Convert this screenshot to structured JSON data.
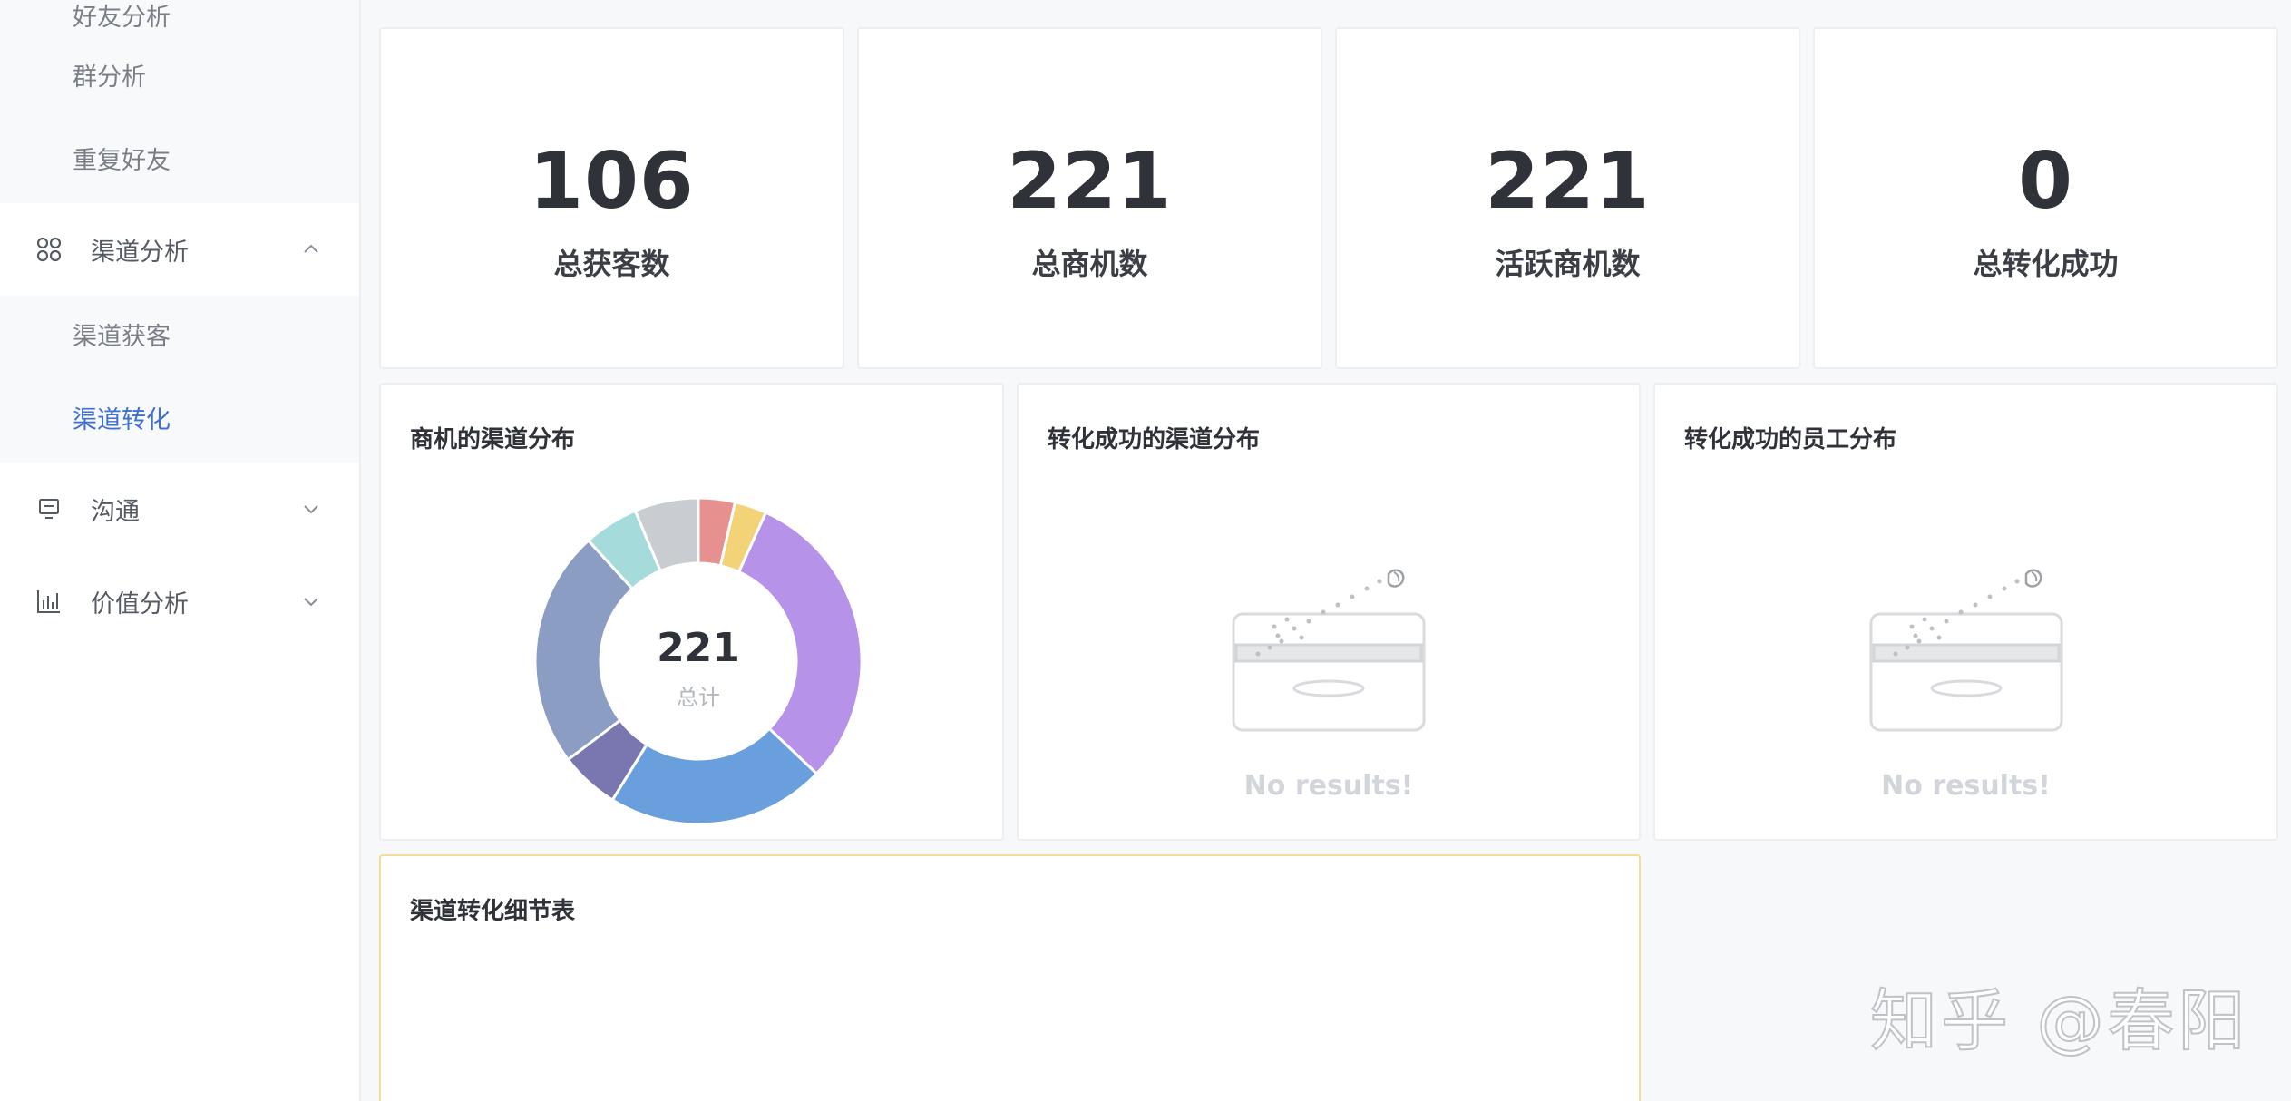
{
  "sidebar": {
    "top_sub_items": [
      {
        "label": "好友分析"
      },
      {
        "label": "群分析"
      },
      {
        "label": "重复好友"
      }
    ],
    "channel_menu": {
      "label": "渠道分析",
      "icon": "command-icon",
      "expanded": true,
      "sub_items": [
        {
          "label": "渠道获客",
          "active": false
        },
        {
          "label": "渠道转化",
          "active": true
        }
      ]
    },
    "communication_menu": {
      "label": "沟通",
      "icon": "monitor-icon",
      "expanded": false
    },
    "value_menu": {
      "label": "价值分析",
      "icon": "bar-chart-icon",
      "expanded": false
    }
  },
  "stats": [
    {
      "value": "106",
      "label": "总获客数"
    },
    {
      "value": "221",
      "label": "总商机数"
    },
    {
      "value": "221",
      "label": "活跃商机数"
    },
    {
      "value": "0",
      "label": "总转化成功"
    }
  ],
  "panels": {
    "channel_distribution": {
      "title": "商机的渠道分布",
      "center_value": "221",
      "center_label": "总计"
    },
    "conversion_channel": {
      "title": "转化成功的渠道分布",
      "empty_text": "No results!"
    },
    "conversion_staff": {
      "title": "转化成功的员工分布",
      "empty_text": "No results!"
    },
    "detail_table": {
      "title": "渠道转化细节表"
    }
  },
  "chart_data": {
    "type": "pie",
    "donut": true,
    "total": 221,
    "center_text": [
      "221",
      "总计"
    ],
    "slices": [
      {
        "value": 8,
        "color": "#e6918f"
      },
      {
        "value": 7,
        "color": "#f2d377"
      },
      {
        "value": 67,
        "color": "#b692e8"
      },
      {
        "value": 48,
        "color": "#6a9fde"
      },
      {
        "value": 13,
        "color": "#7a76b0"
      },
      {
        "value": 52,
        "color": "#8b9dc3"
      },
      {
        "value": 12,
        "color": "#a6dbdc"
      },
      {
        "value": 14,
        "color": "#c9cdd2"
      }
    ]
  },
  "colors": {
    "accent": "#3d6fd6",
    "detail_card_border": "#f1dc9a"
  },
  "watermark": "知乎 @春阳"
}
